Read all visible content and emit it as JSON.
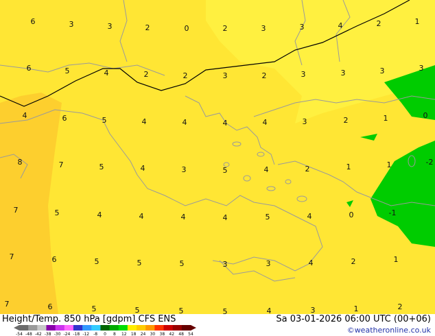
{
  "title": "Height/Temp. 850 hPa [gdpm] CFS ENS",
  "valid_time": "Sa 03-01-2026 06:00 UTC (00+06)",
  "credit": "©weatheronline.co.uk",
  "colors": {
    "background_yellow": "#ffe634",
    "pale_yellow": "#fff040",
    "orange_yellow": "#fdcf2e",
    "green_area": "#00cc00",
    "dark_green_area": "#00aa00",
    "coastline": "#9a9a9a",
    "contour_line": "#000000"
  },
  "temperature_labels": [
    {
      "text": "6"
    },
    {
      "text": "3"
    },
    {
      "text": "3"
    },
    {
      "text": "2"
    },
    {
      "text": "0"
    },
    {
      "text": "2"
    },
    {
      "text": "3"
    },
    {
      "text": "3"
    },
    {
      "text": "4"
    },
    {
      "text": "2"
    },
    {
      "text": "1"
    },
    {
      "text": "6"
    },
    {
      "text": "5"
    },
    {
      "text": "4"
    },
    {
      "text": "2"
    },
    {
      "text": "2"
    },
    {
      "text": "3"
    },
    {
      "text": "2"
    },
    {
      "text": "3"
    },
    {
      "text": "3"
    },
    {
      "text": "3"
    },
    {
      "text": "3"
    },
    {
      "text": "4"
    },
    {
      "text": "6"
    },
    {
      "text": "5"
    },
    {
      "text": "4"
    },
    {
      "text": "4"
    },
    {
      "text": "4"
    },
    {
      "text": "4"
    },
    {
      "text": "3"
    },
    {
      "text": "2"
    },
    {
      "text": "1"
    },
    {
      "text": "0"
    },
    {
      "text": "8"
    },
    {
      "text": "7"
    },
    {
      "text": "5"
    },
    {
      "text": "4"
    },
    {
      "text": "3"
    },
    {
      "text": "5"
    },
    {
      "text": "4"
    },
    {
      "text": "2"
    },
    {
      "text": "1"
    },
    {
      "text": "1"
    },
    {
      "text": "-2"
    },
    {
      "text": "7"
    },
    {
      "text": "5"
    },
    {
      "text": "4"
    },
    {
      "text": "4"
    },
    {
      "text": "4"
    },
    {
      "text": "4"
    },
    {
      "text": "5"
    },
    {
      "text": "4"
    },
    {
      "text": "0"
    },
    {
      "text": "-1"
    },
    {
      "text": "7"
    },
    {
      "text": "6"
    },
    {
      "text": "5"
    },
    {
      "text": "5"
    },
    {
      "text": "5"
    },
    {
      "text": "3"
    },
    {
      "text": "3"
    },
    {
      "text": "4"
    },
    {
      "text": "2"
    },
    {
      "text": "1"
    },
    {
      "text": "7"
    },
    {
      "text": "6"
    },
    {
      "text": "5"
    },
    {
      "text": "5"
    },
    {
      "text": "5"
    },
    {
      "text": "5"
    },
    {
      "text": "4"
    },
    {
      "text": "3"
    },
    {
      "text": "1"
    },
    {
      "text": "2"
    }
  ],
  "scale_ticks": [
    "-54",
    "-48",
    "-42",
    "-38",
    "-30",
    "-24",
    "-18",
    "-12",
    "-8",
    "0",
    "8",
    "12",
    "18",
    "24",
    "30",
    "38",
    "42",
    "48",
    "54"
  ],
  "scale_colors": [
    "#6b6b6b",
    "#9a9a9a",
    "#c8c8c8",
    "#8800aa",
    "#cc33ee",
    "#ff66ff",
    "#3333cc",
    "#3399ff",
    "#33ccff",
    "#006600",
    "#00aa00",
    "#00dd00",
    "#ffee00",
    "#ffcc00",
    "#ff9900",
    "#ff3300",
    "#cc0000",
    "#990000",
    "#660000"
  ]
}
